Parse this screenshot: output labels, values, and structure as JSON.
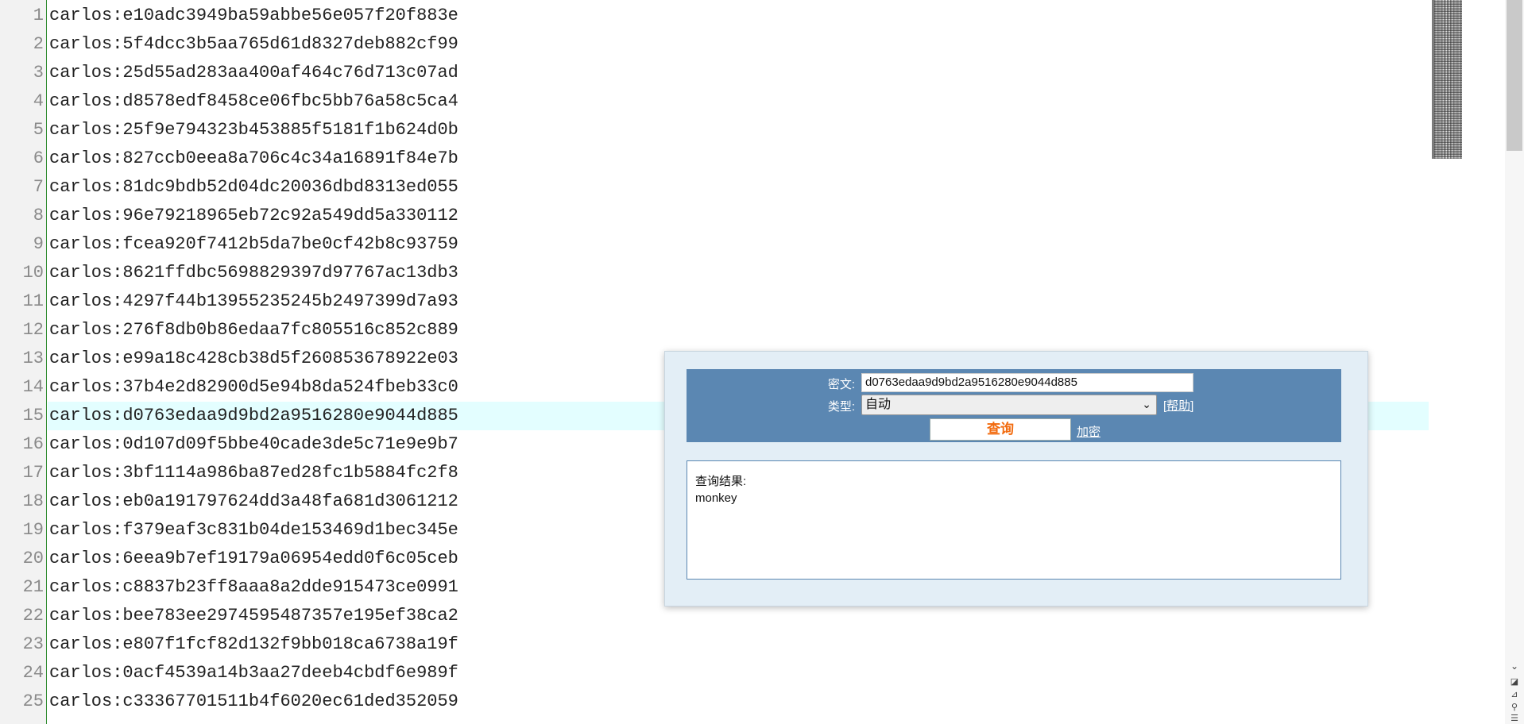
{
  "editor": {
    "current_line": 15,
    "lines": [
      {
        "num": "1",
        "text": "carlos:e10adc3949ba59abbe56e057f20f883e"
      },
      {
        "num": "2",
        "text": "carlos:5f4dcc3b5aa765d61d8327deb882cf99"
      },
      {
        "num": "3",
        "text": "carlos:25d55ad283aa400af464c76d713c07ad"
      },
      {
        "num": "4",
        "text": "carlos:d8578edf8458ce06fbc5bb76a58c5ca4"
      },
      {
        "num": "5",
        "text": "carlos:25f9e794323b453885f5181f1b624d0b"
      },
      {
        "num": "6",
        "text": "carlos:827ccb0eea8a706c4c34a16891f84e7b"
      },
      {
        "num": "7",
        "text": "carlos:81dc9bdb52d04dc20036dbd8313ed055"
      },
      {
        "num": "8",
        "text": "carlos:96e79218965eb72c92a549dd5a330112"
      },
      {
        "num": "9",
        "text": "carlos:fcea920f7412b5da7be0cf42b8c93759"
      },
      {
        "num": "10",
        "text": "carlos:8621ffdbc5698829397d97767ac13db3"
      },
      {
        "num": "11",
        "text": "carlos:4297f44b13955235245b2497399d7a93"
      },
      {
        "num": "12",
        "text": "carlos:276f8db0b86edaa7fc805516c852c889"
      },
      {
        "num": "13",
        "text": "carlos:e99a18c428cb38d5f260853678922e03"
      },
      {
        "num": "14",
        "text": "carlos:37b4e2d82900d5e94b8da524fbeb33c0"
      },
      {
        "num": "15",
        "text": "carlos:d0763edaa9d9bd2a9516280e9044d885"
      },
      {
        "num": "16",
        "text": "carlos:0d107d09f5bbe40cade3de5c71e9e9b7"
      },
      {
        "num": "17",
        "text": "carlos:3bf1114a986ba87ed28fc1b5884fc2f8"
      },
      {
        "num": "18",
        "text": "carlos:eb0a191797624dd3a48fa681d3061212"
      },
      {
        "num": "19",
        "text": "carlos:f379eaf3c831b04de153469d1bec345e"
      },
      {
        "num": "20",
        "text": "carlos:6eea9b7ef19179a06954edd0f6c05ceb"
      },
      {
        "num": "21",
        "text": "carlos:c8837b23ff8aaa8a2dde915473ce0991"
      },
      {
        "num": "22",
        "text": "carlos:bee783ee2974595487357e195ef38ca2"
      },
      {
        "num": "23",
        "text": "carlos:e807f1fcf82d132f9bb018ca6738a19f"
      },
      {
        "num": "24",
        "text": "carlos:0acf4539a14b3aa27deeb4cbdf6e989f"
      },
      {
        "num": "25",
        "text": "carlos:c33367701511b4f6020ec61ded352059"
      }
    ]
  },
  "scrollbar": {
    "down_arrow": "chevron-down-icon",
    "buttons": [
      "bookmark-icon",
      "zoom-icon",
      "search-icon",
      "list-icon"
    ]
  },
  "lookup": {
    "cipher_label": "密文:",
    "cipher_value": "d0763edaa9d9bd2a9516280e9044d885",
    "type_label": "类型:",
    "type_value": "自动",
    "help_link": "[帮助]",
    "query_button": "查询",
    "encrypt_link": "加密",
    "result_label": "查询结果:",
    "result_value": "monkey"
  },
  "colors": {
    "current_line": "#e3feff",
    "panel_bg": "#e3eef6",
    "query_bar": "#5b87b2",
    "query_button_text": "#f26b0f",
    "gutter_border": "#2e8b2e"
  }
}
